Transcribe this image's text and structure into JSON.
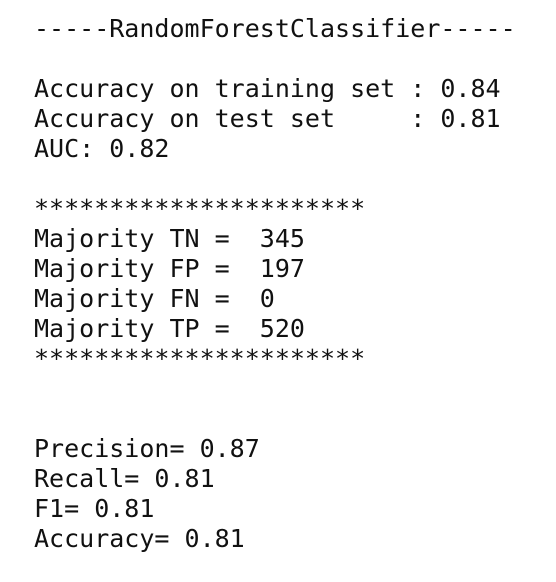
{
  "output": {
    "header": "-----RandomForestClassifier-----",
    "train_accuracy": "Accuracy on training set : 0.84",
    "test_accuracy": "Accuracy on test set     : 0.81",
    "auc": "AUC: 0.82",
    "separator_top": "**********************",
    "majority_tn": "Majority TN =  345",
    "majority_fp": "Majority FP =  197",
    "majority_fn": "Majority FN =  0",
    "majority_tp": "Majority TP =  520",
    "separator_bottom": "**********************",
    "precision": "Precision= 0.87",
    "recall": "Recall= 0.81",
    "f1": "F1= 0.81",
    "accuracy": "Accuracy= 0.81"
  }
}
